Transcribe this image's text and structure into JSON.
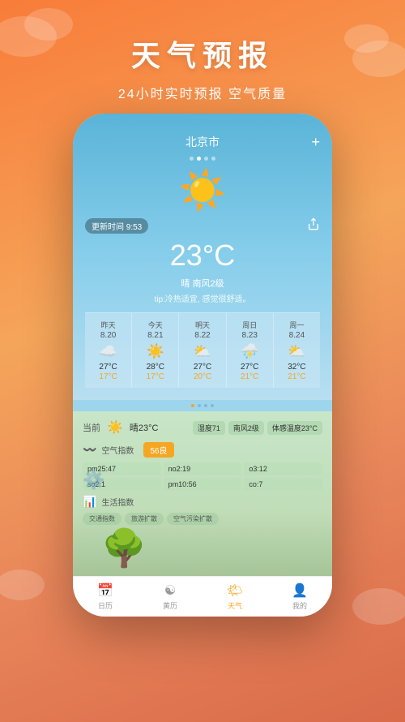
{
  "header": {
    "title": "天气预报",
    "subtitle": "24小时实时预报 空气质量"
  },
  "phone": {
    "city": "北京市",
    "dots": [
      false,
      true,
      false,
      false
    ],
    "update_time": "更新时间  9:53",
    "temperature": "23°C",
    "weather": "晴  南风2级",
    "tip": "tip:冷热适宜, 感觉很舒适。",
    "weekly": [
      {
        "label": "昨天",
        "date": "8.20",
        "icon": "☁️",
        "high": "27°C",
        "low": "17°C"
      },
      {
        "label": "今天",
        "date": "8.21",
        "icon": "☀️",
        "high": "28°C",
        "low": "17°C"
      },
      {
        "label": "明天",
        "date": "8.22",
        "icon": "⛅",
        "high": "27°C",
        "low": "20°C"
      },
      {
        "label": "周日",
        "date": "8.23",
        "icon": "⛈️",
        "high": "27°C",
        "low": "21°C"
      },
      {
        "label": "周一",
        "date": "8.24",
        "icon": "⛅",
        "high": "32°C",
        "low": "21°C"
      }
    ],
    "current": {
      "label": "当前",
      "weather": "晴23°C",
      "humidity": "湿度71",
      "wind": "南风2级",
      "feel": "体感温度23°C"
    },
    "air": {
      "label": "空气指数",
      "index": "56良",
      "pm25": "pm25:47",
      "no2": "no2:19",
      "o3": "o3:12",
      "so2": "so2:1",
      "pm10": "pm10:56",
      "co": "co:7"
    },
    "life": {
      "label": "生活指数",
      "tags": [
        "交通指数",
        "旅游扩散",
        "空气污染扩散"
      ]
    },
    "nav": [
      {
        "label": "日历",
        "icon": "📅",
        "active": false
      },
      {
        "label": "黄历",
        "icon": "☯",
        "active": false
      },
      {
        "label": "天气",
        "icon": "🌤",
        "active": true
      },
      {
        "label": "我的",
        "icon": "👤",
        "active": false
      }
    ]
  },
  "colors": {
    "accent": "#f5a623",
    "bg_gradient_start": "#f87c3a",
    "bg_gradient_end": "#d96b4a",
    "active_nav": "#f5a623"
  }
}
